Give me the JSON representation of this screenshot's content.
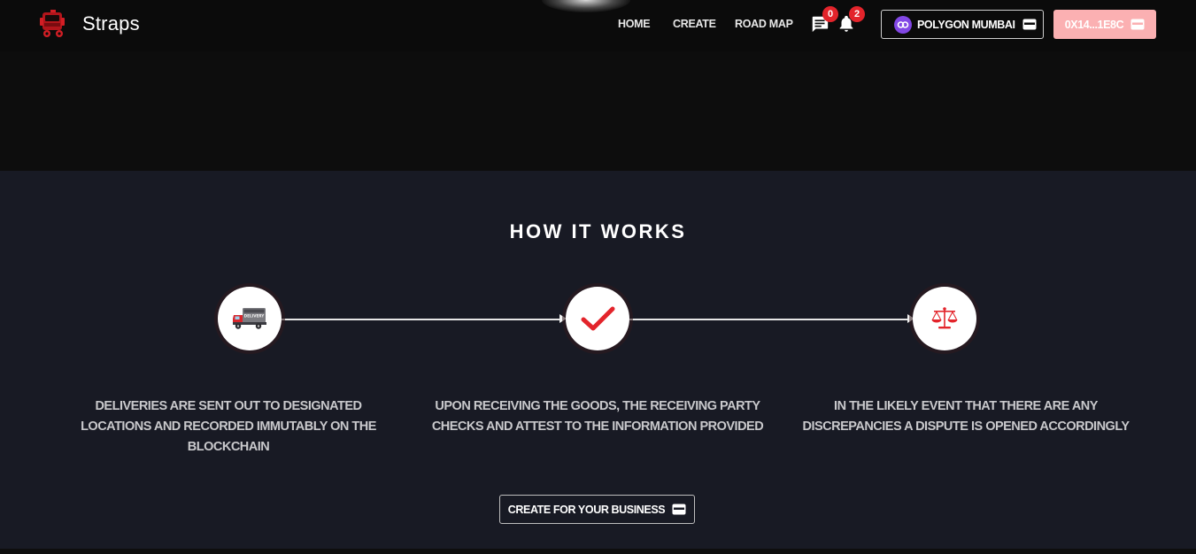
{
  "brand": {
    "name": "Straps",
    "logo_icon": "truck-icon"
  },
  "nav": {
    "home": "HOME",
    "create": "CREATE",
    "roadmap": "ROAD MAP",
    "messages_count": "0",
    "notifications_count": "2"
  },
  "wallet": {
    "network_label": "POLYGON MUMBAI",
    "account_label": "0X14...1E8C",
    "network_color": "#8247e5",
    "account_bg": "#fbb0b2"
  },
  "how_it_works": {
    "title": "HOW IT WORKS",
    "steps": [
      {
        "icon": "delivery-truck-icon",
        "text": "DELIVERIES ARE SENT OUT TO DESIGNATED LOCATIONS AND RECORDED IMMUTABLY ON THE BLOCKCHAIN",
        "icon_label": "DELIVERY"
      },
      {
        "icon": "checkmark-icon",
        "text": "UPON RECEIVING THE GOODS, THE RECEIVING PARTY CHECKS AND ATTEST TO THE INFORMATION PROVIDED"
      },
      {
        "icon": "scales-icon",
        "text": "IN THE LIKELY EVENT THAT THERE ARE ANY DISCREPANCIES A DISPUTE IS OPENED ACCORDINGLY"
      }
    ],
    "cta_label": "CREATE FOR YOUR BUSINESS"
  },
  "colors": {
    "accent_red": "#e3242b",
    "section_bg": "#181a24",
    "header_bg": "#0b0b0b"
  }
}
